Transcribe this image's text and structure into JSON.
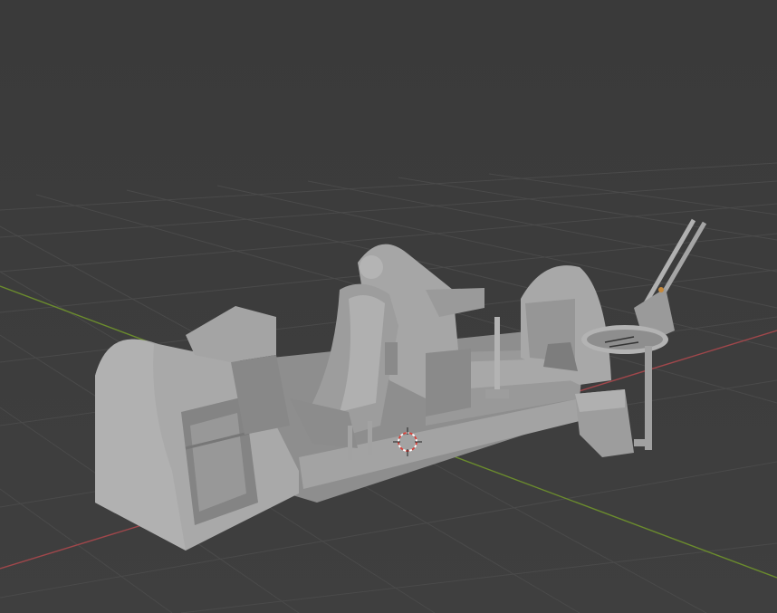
{
  "viewport": {
    "mode": "solid",
    "colors": {
      "background": "#3d3d3d",
      "grid_line": "#4a4a4a",
      "x_axis": "#a0474b",
      "y_axis": "#6b8c2d",
      "mesh_light": "#a9a9a9",
      "mesh_mid": "#8f8f8f",
      "mesh_dark": "#6e6e6e",
      "cursor_red": "#d9413a"
    },
    "objects": [
      {
        "name": "cockpit-tub",
        "type": "mesh"
      },
      {
        "name": "pilot-seat",
        "type": "mesh"
      },
      {
        "name": "control-stick",
        "type": "mesh"
      },
      {
        "name": "twin-gun-mount",
        "type": "mesh"
      }
    ],
    "icons": {
      "cursor": "3d-cursor-icon"
    }
  }
}
